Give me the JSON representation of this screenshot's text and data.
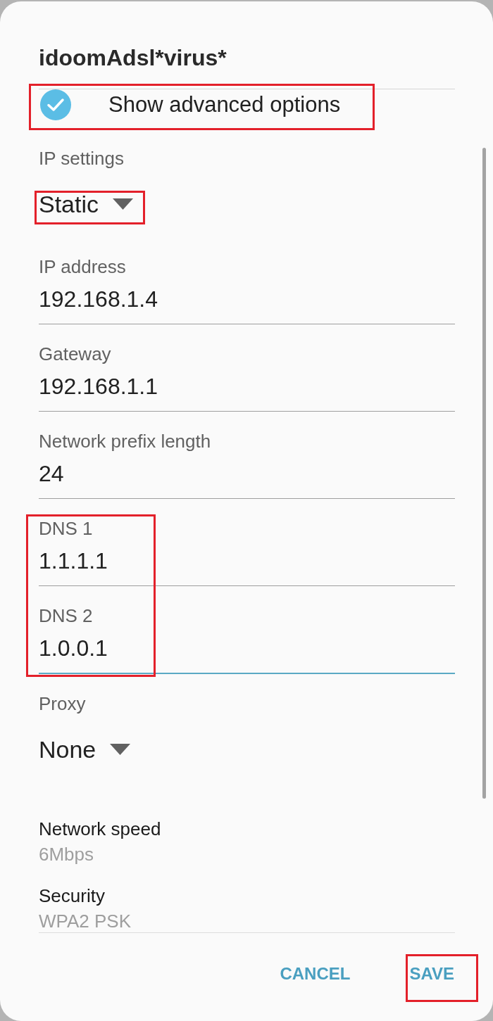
{
  "dialog": {
    "title": "idoomAdsl*virus*"
  },
  "advanced_options": {
    "label": "Show advanced options",
    "checked": true,
    "highlighted": true
  },
  "settings": [
    {
      "kind": "dropdown",
      "label": "IP settings",
      "value": "Static",
      "highlighted": true
    },
    {
      "kind": "input",
      "label": "IP address",
      "value": "192.168.1.4",
      "focused": false,
      "highlighted": false
    },
    {
      "kind": "input",
      "label": "Gateway",
      "value": "192.168.1.1",
      "focused": false,
      "highlighted": false
    },
    {
      "kind": "input",
      "label": "Network prefix length",
      "value": "24",
      "focused": false,
      "highlighted": false
    },
    {
      "kind": "input",
      "label": "DNS 1",
      "value": "1.1.1.1",
      "focused": false,
      "highlighted": true
    },
    {
      "kind": "input",
      "label": "DNS 2",
      "value": "1.0.0.1",
      "focused": true,
      "highlighted": true
    },
    {
      "kind": "dropdown",
      "label": "Proxy",
      "value": "None",
      "highlighted": false
    },
    {
      "kind": "info",
      "label": "Network speed",
      "value": "6Mbps"
    },
    {
      "kind": "info",
      "label": "Security",
      "value": "WPA2 PSK"
    }
  ],
  "buttons": [
    {
      "label": "CANCEL",
      "highlighted": false
    },
    {
      "label": "SAVE",
      "highlighted": true
    }
  ]
}
